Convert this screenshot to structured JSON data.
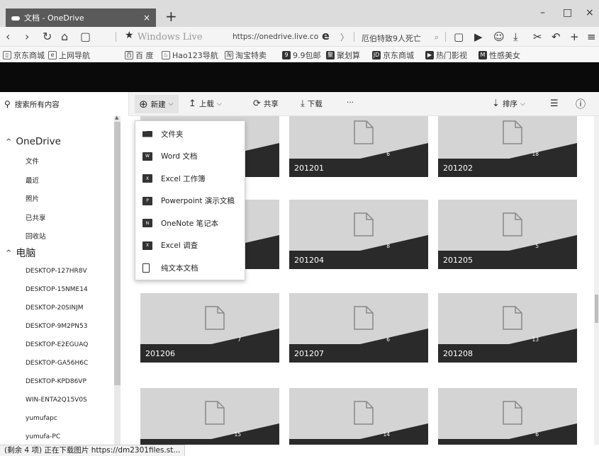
{
  "browser": {
    "tab_title": "文档 - OneDrive",
    "tab_close": "×",
    "new_tab": "+",
    "window_controls": {
      "minimize": "–",
      "maximize": "□",
      "close": "×"
    },
    "nav": {
      "back": "‹",
      "forward": "›",
      "refresh": "↻",
      "home": "⌂",
      "reader": "▢"
    },
    "star": "★",
    "address_title": "Windows Live",
    "address_url": "https://onedrive.live.co",
    "ie_icon": "e",
    "address_more": "〉",
    "news_ticker": "厄伯特致9人死亡",
    "search_icon": "⌕",
    "toolbar_icons": [
      "▢",
      "▶",
      "☺",
      "⤓",
      "✂",
      "↶",
      "+",
      "≡"
    ],
    "favorites": [
      {
        "icon": "▯",
        "label": "京东商城"
      },
      {
        "icon": "e",
        "label": "上网导航"
      },
      {
        "icon": "百",
        "label": "百 度"
      },
      {
        "icon": "♨",
        "label": "Hao123导航"
      },
      {
        "icon": "淘",
        "label": "淘宝特卖"
      },
      {
        "icon": "9",
        "label": "9.9包邮"
      },
      {
        "icon": "聚",
        "label": "聚划算"
      },
      {
        "icon": "JD",
        "label": "京东商城"
      },
      {
        "icon": "▶",
        "label": "热门影视"
      },
      {
        "icon": "M",
        "label": "性感美女"
      }
    ]
  },
  "command_bar": {
    "search_placeholder": "搜索所有内容",
    "new": "新建",
    "upload": "上载",
    "share": "共享",
    "download": "下载",
    "more": "···",
    "sort": "排序",
    "view_icon": "☰",
    "info_icon": "ⓘ"
  },
  "sidebar": {
    "onedrive_heading": "OneDrive",
    "onedrive_items": [
      "文件",
      "最近",
      "照片",
      "已共享",
      "回收站"
    ],
    "pc_heading": "电脑",
    "pc_items": [
      "DESKTOP-127HR8V",
      "DESKTOP-15NME14",
      "DESKTOP-20SINJM",
      "DESKTOP-9M2PN53",
      "DESKTOP-E2EGUAQ",
      "DESKTOP-GA56H6C",
      "DESKTOP-KPD86VP",
      "WIN-ENTA2Q15V0S",
      "yumufapc",
      "yumufa-PC"
    ]
  },
  "new_menu": {
    "items": [
      {
        "icon": "folder-icon",
        "glyph": "",
        "label": "文件夹"
      },
      {
        "icon": "word-icon",
        "glyph": "W",
        "label": "Word 文档"
      },
      {
        "icon": "excel-icon",
        "glyph": "X",
        "label": "Excel 工作簿"
      },
      {
        "icon": "powerpoint-icon",
        "glyph": "P",
        "label": "Powerpoint 演示文稿"
      },
      {
        "icon": "onenote-icon",
        "glyph": "N",
        "label": "OneNote 笔记本"
      },
      {
        "icon": "excel-survey-icon",
        "glyph": "X",
        "label": "Excel 调查"
      },
      {
        "icon": "text-file-icon",
        "glyph": "",
        "label": "纯文本文档"
      }
    ]
  },
  "tiles": [
    {
      "name": "",
      "count": "",
      "col": 0,
      "row": 0
    },
    {
      "name": "201201",
      "count": "6",
      "col": 1,
      "row": 0
    },
    {
      "name": "201202",
      "count": "18",
      "col": 2,
      "row": 0
    },
    {
      "name": "",
      "count": "",
      "col": 0,
      "row": 1
    },
    {
      "name": "201204",
      "count": "8",
      "col": 1,
      "row": 1
    },
    {
      "name": "201205",
      "count": "5",
      "col": 2,
      "row": 1
    },
    {
      "name": "201206",
      "count": "7",
      "col": 0,
      "row": 2
    },
    {
      "name": "201207",
      "count": "6",
      "col": 1,
      "row": 2
    },
    {
      "name": "201208",
      "count": "13",
      "col": 2,
      "row": 2
    },
    {
      "name": "",
      "count": "15",
      "col": 0,
      "row": 3
    },
    {
      "name": "",
      "count": "14",
      "col": 1,
      "row": 3
    },
    {
      "name": "",
      "count": "6",
      "col": 2,
      "row": 3
    }
  ],
  "status": "(剩余 4 项) 正在下载图片 https://dm2301files.st...",
  "colors": {
    "tab": "#5a5a5a",
    "tile": "#d4d4d4",
    "tile_bar": "#2a2a2a",
    "header_band": "#0a0a0a"
  }
}
